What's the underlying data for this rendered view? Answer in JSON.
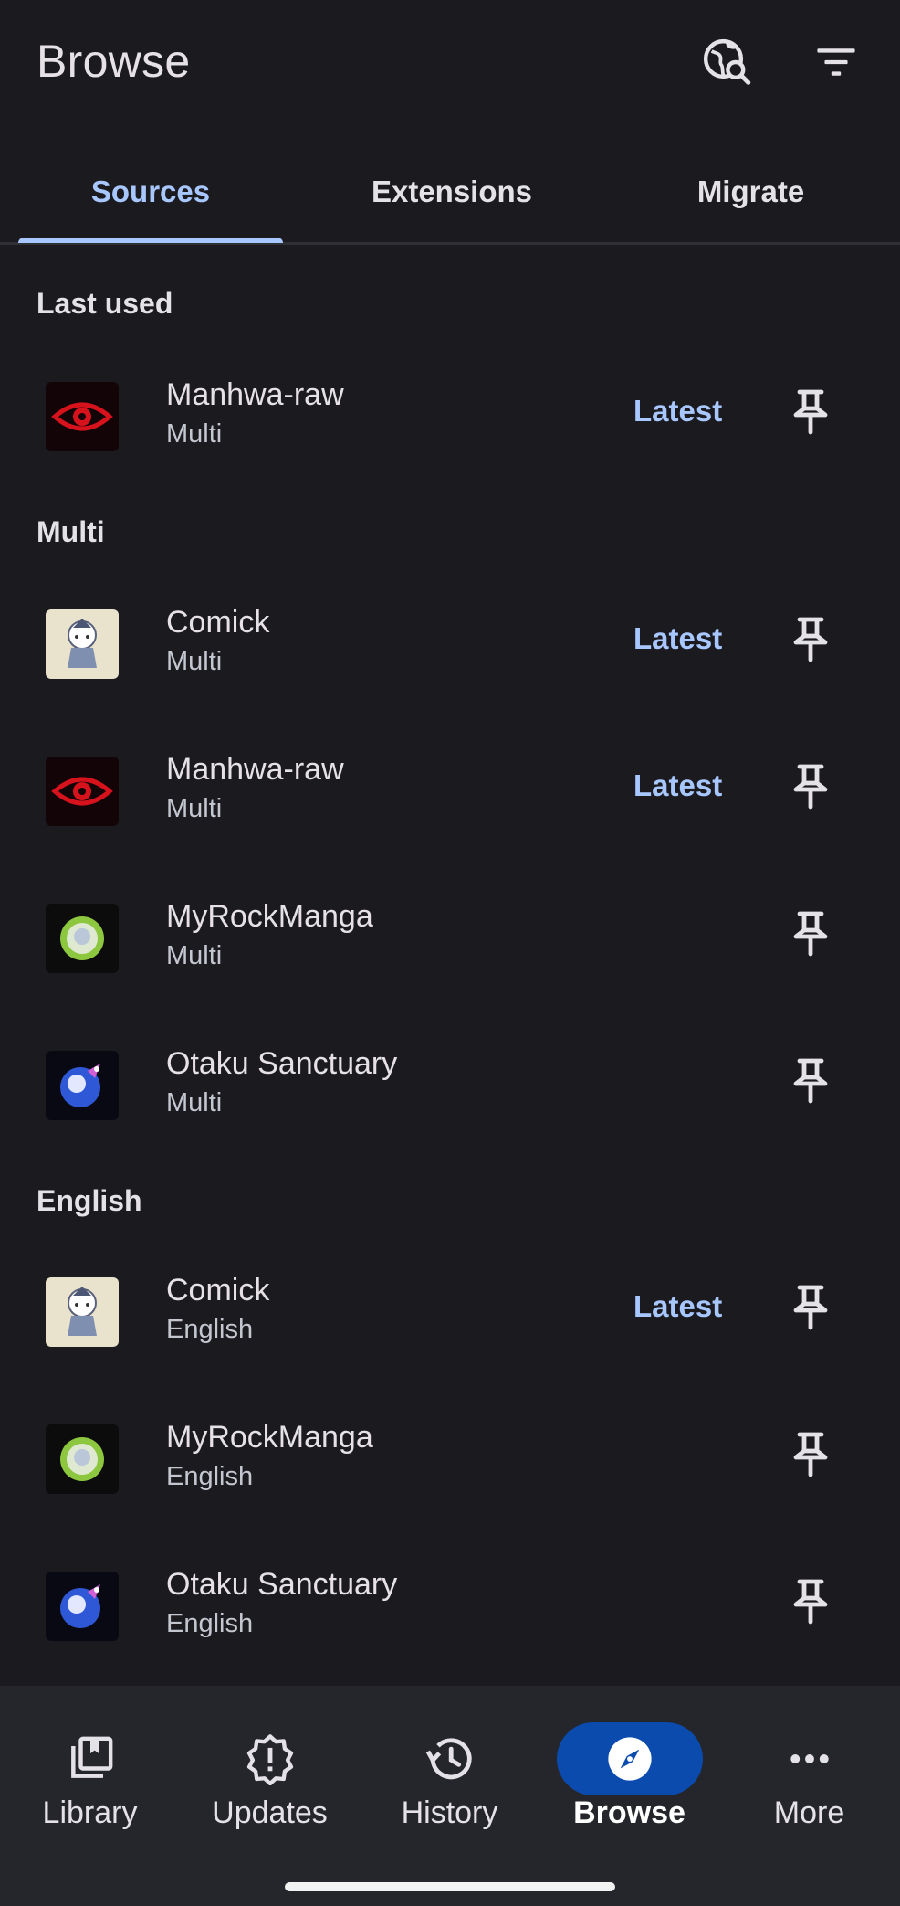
{
  "header": {
    "title": "Browse"
  },
  "tabs": [
    {
      "label": "Sources"
    },
    {
      "label": "Extensions"
    },
    {
      "label": "Migrate"
    }
  ],
  "sections": [
    {
      "title": "Last used"
    },
    {
      "title": "Multi"
    },
    {
      "title": "English"
    }
  ],
  "sources": [
    {
      "name": "Manhwa-raw",
      "lang": "Multi",
      "latest": "Latest",
      "icon": "eye-logo-icon"
    },
    {
      "name": "Comick",
      "lang": "Multi",
      "latest": "Latest",
      "icon": "comick-logo-icon"
    },
    {
      "name": "Manhwa-raw",
      "lang": "Multi",
      "latest": "Latest",
      "icon": "eye-logo-icon"
    },
    {
      "name": "MyRockManga",
      "lang": "Multi",
      "icon": "myrockmanga-logo-icon"
    },
    {
      "name": "Otaku Sanctuary",
      "lang": "Multi",
      "icon": "otaku-sanctuary-logo-icon"
    },
    {
      "name": "Comick",
      "lang": "English",
      "latest": "Latest",
      "icon": "comick-logo-icon"
    },
    {
      "name": "MyRockManga",
      "lang": "English",
      "icon": "myrockmanga-logo-icon"
    },
    {
      "name": "Otaku Sanctuary",
      "lang": "English",
      "icon": "otaku-sanctuary-logo-icon"
    }
  ],
  "nav": [
    {
      "label": "Library",
      "icon": "library-icon"
    },
    {
      "label": "Updates",
      "icon": "updates-icon"
    },
    {
      "label": "History",
      "icon": "history-icon"
    },
    {
      "label": "Browse",
      "icon": "compass-icon"
    },
    {
      "label": "More",
      "icon": "more-icon"
    }
  ],
  "colors": {
    "background": "#1b1b1f",
    "accent": "#a9c7ff",
    "nav_active": "#0a4bad"
  }
}
